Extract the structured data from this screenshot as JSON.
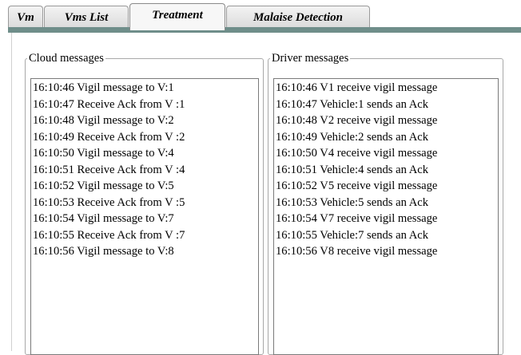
{
  "tabs": [
    {
      "label": "Vm",
      "active": false
    },
    {
      "label": "Vms List",
      "active": false
    },
    {
      "label": "Treatment",
      "active": true
    },
    {
      "label": "Malaise Detection",
      "active": false
    }
  ],
  "colors": {
    "tab_bar": "#6f8e8a"
  },
  "cloud": {
    "title": "Cloud messages",
    "messages": [
      "16:10:46 Vigil message to V:1",
      "16:10:47 Receive Ack from V :1",
      "16:10:48 Vigil message to V:2",
      "16:10:49 Receive Ack from V :2",
      "16:10:50 Vigil message to V:4",
      "16:10:51 Receive Ack from V :4",
      "16:10:52 Vigil message to V:5",
      "16:10:53 Receive Ack from V :5",
      "16:10:54 Vigil message to V:7",
      "16:10:55 Receive Ack from V :7",
      "16:10:56 Vigil message to V:8"
    ]
  },
  "driver": {
    "title": "Driver messages",
    "messages": [
      "16:10:46 V1 receive vigil message",
      "16:10:47 Vehicle:1 sends an Ack",
      "16:10:48 V2 receive vigil message",
      "16:10:49 Vehicle:2 sends an Ack",
      "16:10:50 V4 receive vigil message",
      "16:10:51 Vehicle:4 sends an Ack",
      "16:10:52 V5 receive vigil message",
      "16:10:53 Vehicle:5 sends an Ack",
      "16:10:54 V7 receive vigil message",
      "16:10:55 Vehicle:7 sends an Ack",
      "16:10:56 V8 receive vigil message"
    ]
  }
}
